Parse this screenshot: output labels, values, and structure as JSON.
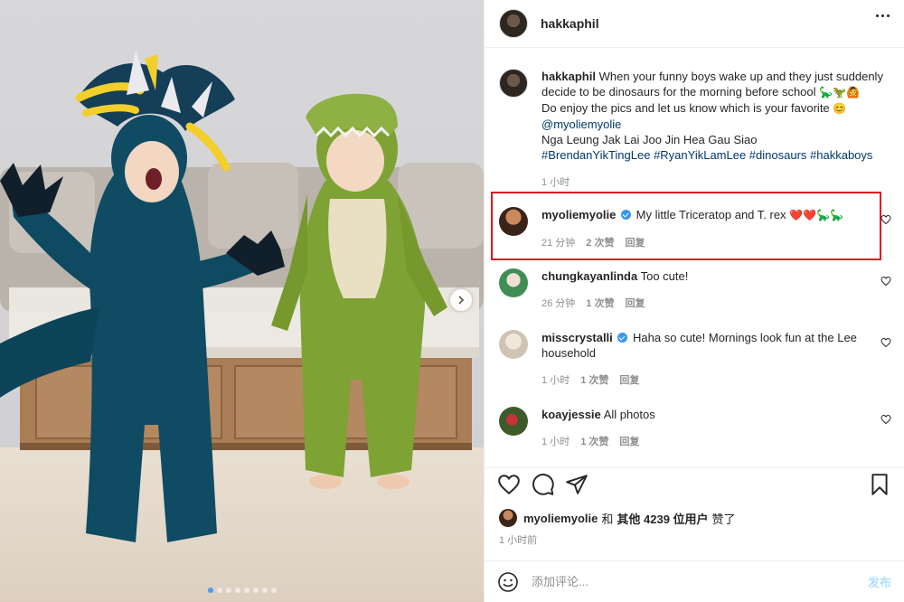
{
  "header": {
    "username": "hakkaphil"
  },
  "caption": {
    "username": "hakkaphil",
    "line1": "When your funny boys wake up and they just suddenly decide to be dinosaurs for the morning before school",
    "emojis": "🦕🦖🙆",
    "line2": "Do enjoy the pics and let us know which is your favorite",
    "smile": "😊",
    "mention": "@myoliemyolie",
    "line3": "Nga Leung Jak Lai Joo Jin Hea Gau Siao",
    "hashtags": "#BrendanYikTingLee #RyanYikLamLee #dinosaurs #hakkaboys",
    "time": "1 小时"
  },
  "comments": [
    {
      "username": "myoliemyolie",
      "verified": true,
      "text": "My little Triceratop and T. rex",
      "hearts": "❤️❤️",
      "dinos": "🦕🦕",
      "time": "21 分钟",
      "likes": "2 次赞",
      "reply": "回复"
    },
    {
      "username": "chungkayanlinda",
      "verified": false,
      "text": "Too cute!",
      "time": "26 分钟",
      "likes": "1 次赞",
      "reply": "回复"
    },
    {
      "username": "misscrystalli",
      "verified": true,
      "text": "Haha so cute! Mornings look fun at the Lee household",
      "time": "1 小时",
      "likes": "1 次赞",
      "reply": "回复"
    },
    {
      "username": "koayjessie",
      "verified": false,
      "text": "All photos",
      "time": "1 小时",
      "likes": "1 次赞",
      "reply": "回复"
    }
  ],
  "likes": {
    "username": "myoliemyolie",
    "connector": "和",
    "others": "其他 4239 位用户",
    "suffix": "赞了"
  },
  "post_time": "1 小时前",
  "add_comment": {
    "placeholder": "添加评论...",
    "post_label": "发布"
  },
  "colors": {
    "link": "#00376b",
    "verified": "#3897f0",
    "highlight": "#e0141e",
    "post_disabled": "#b2dffc"
  },
  "icons": [
    "more-icon",
    "heart-icon",
    "comment-icon",
    "share-icon",
    "bookmark-icon",
    "emoji-icon",
    "chevron-right-icon",
    "verified-icon"
  ],
  "carousel": {
    "count": 8,
    "active": 1
  }
}
